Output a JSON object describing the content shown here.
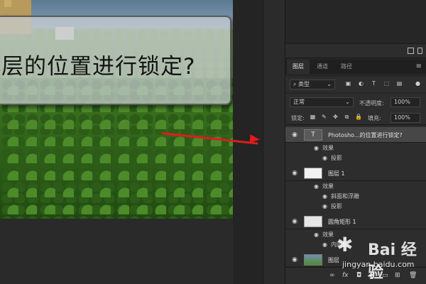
{
  "canvas": {
    "overlay_text": "层的位置进行锁定?"
  },
  "panel": {
    "tabs": [
      {
        "label": "图层"
      },
      {
        "label": "通道"
      },
      {
        "label": "路径"
      }
    ],
    "filter_select": "类型",
    "blend_mode": "正常",
    "opacity_label": "不透明度:",
    "opacity_value": "100%",
    "lock_label": "锁定:",
    "fill_label": "填充:",
    "fill_value": "100%",
    "layers": [
      {
        "name": "Photosho...的位置进行锁定?",
        "kind": "text",
        "selected": true,
        "effects_label": "效果",
        "effects": [
          "投影"
        ]
      },
      {
        "name": "图层 1",
        "kind": "pixel",
        "effects_label": "效果",
        "effects": [
          "斜面和浮雕",
          "投影"
        ]
      },
      {
        "name": "圆角矩形 1",
        "kind": "shape",
        "effects_label": "效果",
        "effects": [
          "内阴影"
        ]
      },
      {
        "name": "图层",
        "kind": "image"
      }
    ]
  },
  "watermark": {
    "brand": "Bai 经验",
    "url": "jingyan.baidu.com"
  },
  "colors": {
    "arrow": "#e01c1c",
    "panel_bg": "#2d2d2d",
    "selected_layer": "#474747"
  }
}
